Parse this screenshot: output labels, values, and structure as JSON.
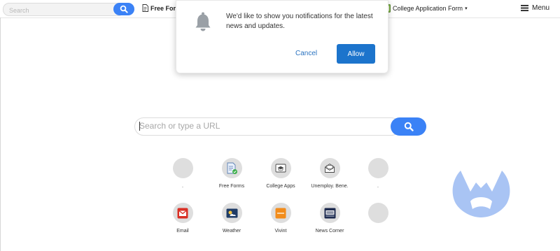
{
  "toolbar": {
    "search_placeholder": "Search",
    "links": [
      {
        "label": "Free Form"
      },
      {
        "label": "College Application Form",
        "caret": "▾"
      }
    ],
    "menu_label": "Menu"
  },
  "notification": {
    "message": "We'd like to show you notifications for the latest news and updates.",
    "cancel_label": "Cancel",
    "allow_label": "Allow"
  },
  "main": {
    "search_placeholder": "Search or type a URL"
  },
  "tiles": [
    {
      "label": ".",
      "icon": "empty"
    },
    {
      "label": "Free Forms",
      "icon": "document-check-icon"
    },
    {
      "label": "College Apps",
      "icon": "graduation-cap-icon"
    },
    {
      "label": "Unemploy. Bene.",
      "icon": "envelope-icon"
    },
    {
      "label": ".",
      "icon": "empty"
    },
    {
      "label": "Email",
      "icon": "gmail-icon"
    },
    {
      "label": "Weather",
      "icon": "weather-icon"
    },
    {
      "label": "Vivint",
      "icon": "vivint-icon"
    },
    {
      "label": "News Corner",
      "icon": "news-icon"
    },
    {
      "label": "",
      "icon": "empty"
    }
  ],
  "colors": {
    "accent_blue": "#3b82f6",
    "allow_blue": "#1c74cc",
    "watermark": "#a9c4f4"
  }
}
